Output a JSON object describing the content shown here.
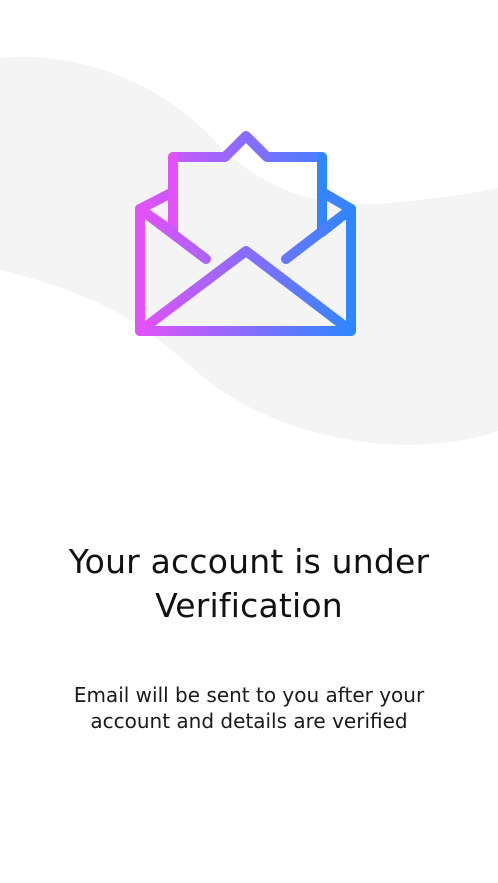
{
  "screen": {
    "title": "Your account is under Verification",
    "message": "Email will be sent to you after your account and details are verified"
  },
  "illustration": {
    "icon_name": "open-envelope-icon",
    "background_shape_color": "#f4f4f5",
    "gradient_start": "#e352f7",
    "gradient_end": "#2f86ff"
  }
}
